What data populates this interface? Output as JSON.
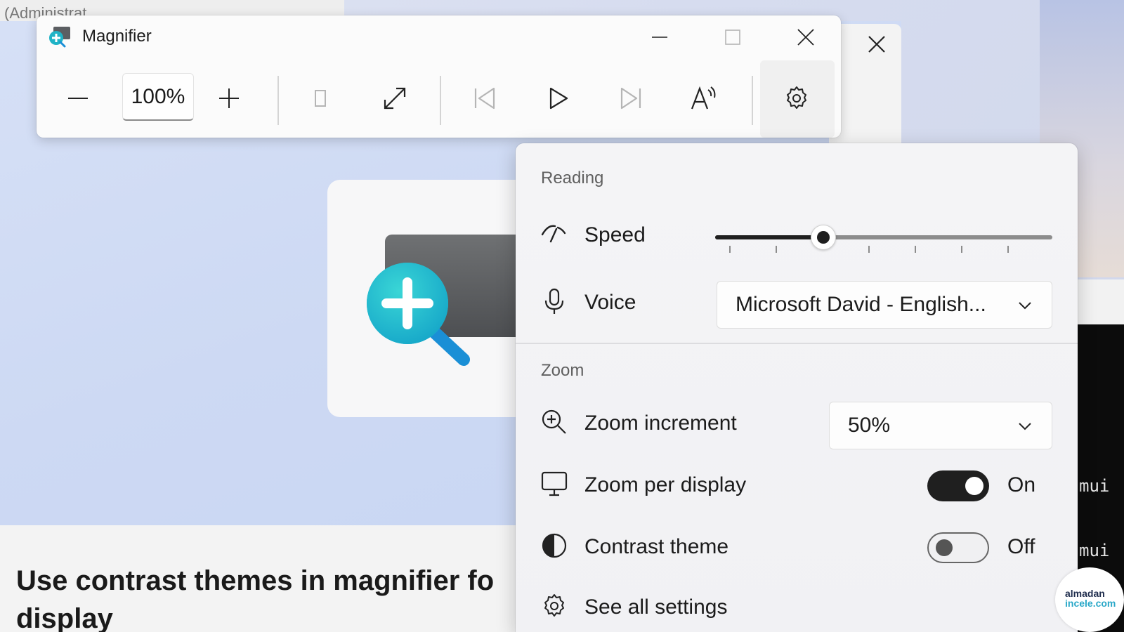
{
  "background": {
    "admin_window_title": "(Administrat",
    "article_title": "Use contrast themes in magnifier fo display",
    "terminal_lines": [
      "mui",
      "mui"
    ],
    "watermark_line1": "almadan",
    "watermark_line2": "incele.com"
  },
  "magnifier": {
    "title": "Magnifier",
    "zoom_value": "100%"
  },
  "flyout": {
    "reading_label": "Reading",
    "speed_label": "Speed",
    "speed_value_fraction": 0.32,
    "voice_label": "Voice",
    "voice_value": "Microsoft David - English...",
    "zoom_label": "Zoom",
    "zoom_increment_label": "Zoom increment",
    "zoom_increment_value": "50%",
    "zoom_per_display_label": "Zoom per display",
    "zoom_per_display_state": "On",
    "contrast_theme_label": "Contrast theme",
    "contrast_theme_state": "Off",
    "see_all_settings_label": "See all settings"
  },
  "colors": {
    "accent": "#1f1f1f",
    "icon_teal": "#1fb3c6"
  }
}
